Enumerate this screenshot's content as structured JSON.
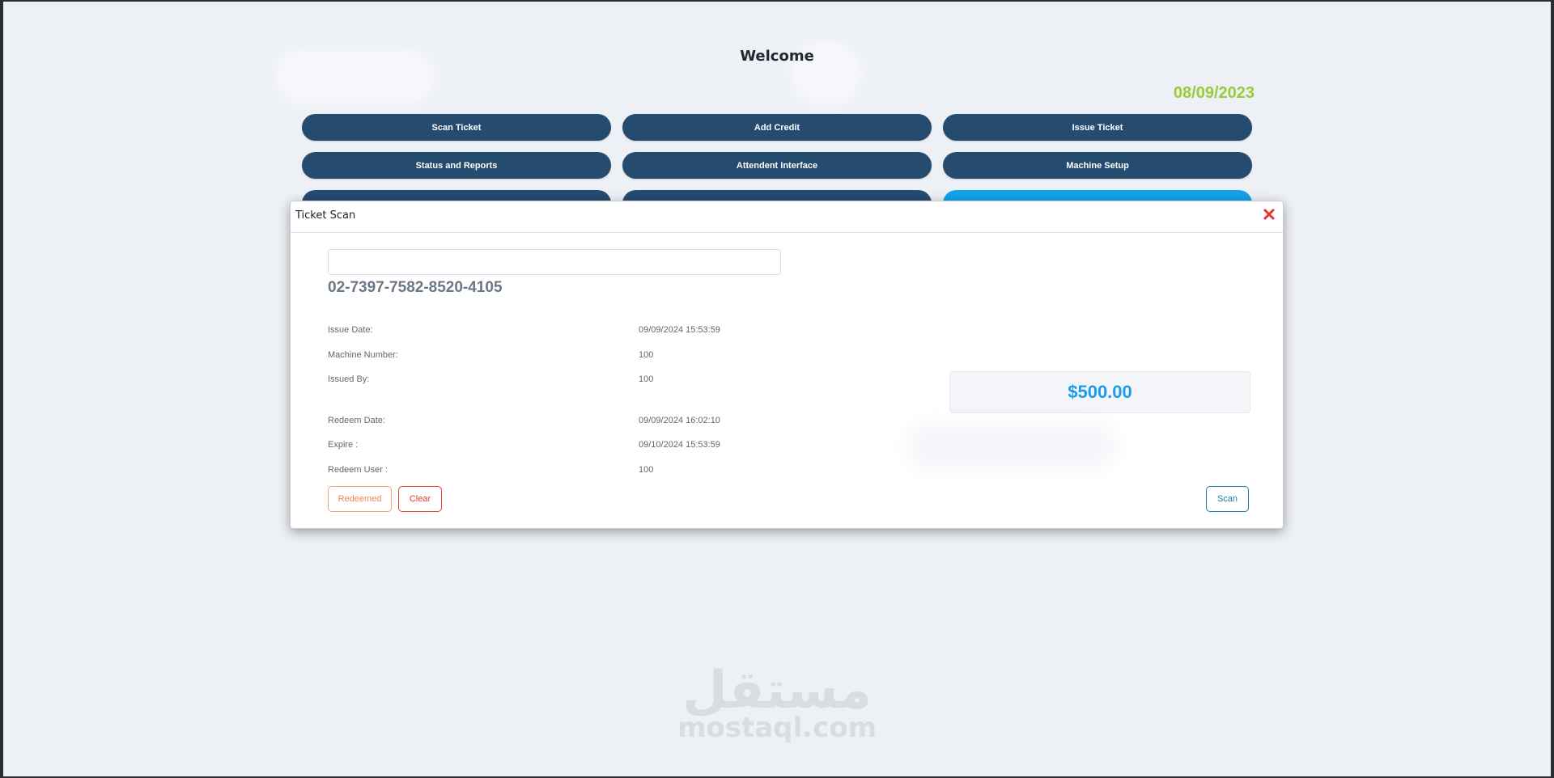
{
  "page": {
    "welcome_text": "Welcome",
    "date": "08/09/2023"
  },
  "menu": {
    "items": [
      {
        "label": "Scan Ticket"
      },
      {
        "label": "Add Credit"
      },
      {
        "label": "Issue Ticket"
      },
      {
        "label": "Status and Reports"
      },
      {
        "label": "Attendent Interface"
      },
      {
        "label": "Machine Setup"
      },
      {
        "label": ""
      },
      {
        "label": ""
      },
      {
        "label": ""
      }
    ]
  },
  "dialog": {
    "title": "Ticket Scan",
    "input_value": "",
    "ticket_number": "02-7397-7582-8520-4105",
    "fields": [
      {
        "label": "Issue Date:",
        "value": "09/09/2024 15:53:59"
      },
      {
        "label": "Machine Number:",
        "value": "100"
      },
      {
        "label": "Issued By:",
        "value": "100"
      },
      {
        "label": "Redeem Date:",
        "value": "09/09/2024 16:02:10"
      },
      {
        "label": "Expire :",
        "value": "09/10/2024 15:53:59"
      },
      {
        "label": "Redeem User :",
        "value": "100"
      }
    ],
    "amount": "$500.00",
    "buttons": {
      "redeemed": "Redeemed",
      "clear": "Clear",
      "scan": "Scan"
    }
  },
  "watermark": {
    "arabic": "مستقل",
    "latin": "mostaql.com"
  },
  "colors": {
    "nav_button": "#254b6f",
    "active_button": "#13a2e9",
    "date": "#9acb3a",
    "amount": "#1d9bea",
    "danger": "#e0442f"
  },
  "icons": {
    "close": "close-icon"
  }
}
